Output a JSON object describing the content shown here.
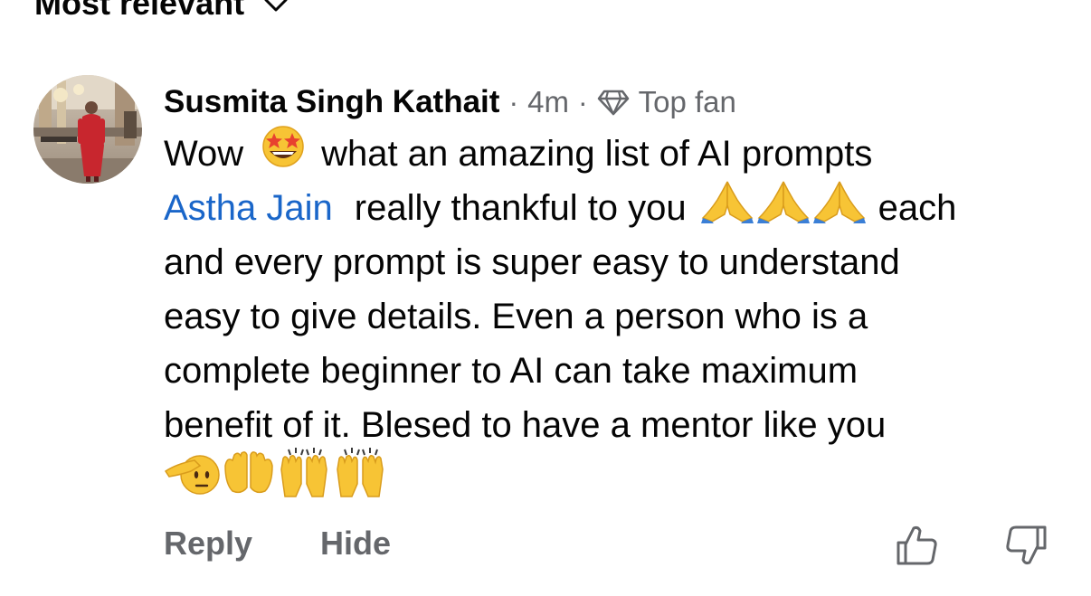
{
  "sort": {
    "label": "Most relevant"
  },
  "comment": {
    "author": "Susmita Singh Kathait",
    "separator": "·",
    "time": "4m",
    "badge": "Top fan",
    "text": {
      "line1_a": "Wow",
      "line1_b": "what an amazing list of AI prompts",
      "mention": "Astha Jain",
      "line2_b": "really thankful to you",
      "line2_c": "each",
      "line3": "and every prompt is super easy to understand",
      "line4": "easy to give details. Even a person who is a",
      "line5": "complete beginner to AI can take maximum",
      "line6": "benefit of it. Blesed to have a mentor like you"
    },
    "emojis": {
      "star_struck": "star-struck-emoji",
      "folded_hands": "folded-hands-emoji",
      "saluting_face": "saluting-face-emoji",
      "open_hands": "open-hands-emoji",
      "raising_hands": "raising-hands-emoji"
    }
  },
  "actions": {
    "reply": "Reply",
    "hide": "Hide"
  },
  "colors": {
    "text": "#050505",
    "secondary": "#65676b",
    "mention": "#1a66c9",
    "emoji_yellow": "#f7c435"
  }
}
